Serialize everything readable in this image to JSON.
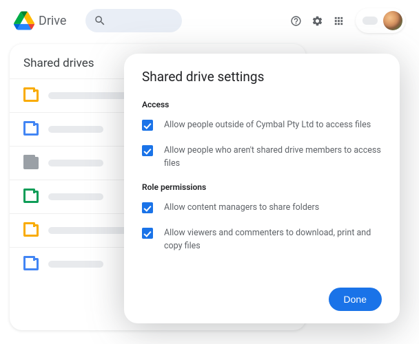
{
  "app": {
    "name": "Drive"
  },
  "sidebar": {
    "title": "Shared drives"
  },
  "dialog": {
    "title": "Shared drive settings",
    "sections": {
      "access": {
        "label": "Access",
        "items": [
          {
            "text": "Allow people outside of Cymbal Pty Ltd to access files",
            "checked": true
          },
          {
            "text": "Allow people who aren't shared drive members to access files",
            "checked": true
          }
        ]
      },
      "roles": {
        "label": "Role permissions",
        "items": [
          {
            "text": "Allow content managers to share folders",
            "checked": true
          },
          {
            "text": "Allow viewers and commenters to download, print and copy files",
            "checked": true
          }
        ]
      }
    },
    "done": "Done"
  }
}
